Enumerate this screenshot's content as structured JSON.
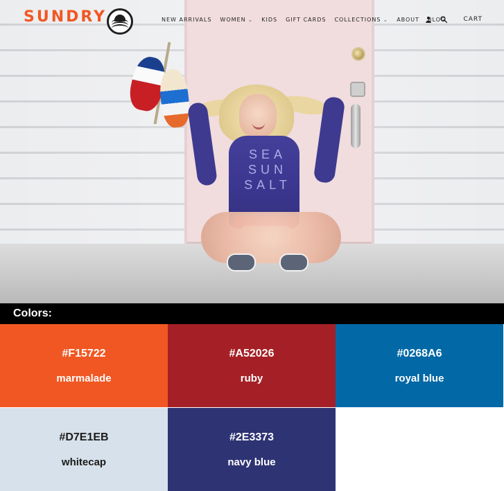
{
  "header": {
    "brand": "SUNDRY",
    "nav": [
      {
        "label": "NEW ARRIVALS",
        "has_dropdown": false
      },
      {
        "label": "WOMEN",
        "has_dropdown": true
      },
      {
        "label": "KIDS",
        "has_dropdown": false
      },
      {
        "label": "GIFT CARDS",
        "has_dropdown": false
      },
      {
        "label": "COLLECTIONS",
        "has_dropdown": true
      },
      {
        "label": "ABOUT",
        "has_dropdown": false
      },
      {
        "label": "BLOG",
        "has_dropdown": false
      }
    ],
    "utils": {
      "account_icon": "user-icon",
      "search_icon": "search-icon",
      "cart_label": "CART"
    }
  },
  "hero": {
    "sweatshirt_text": "SEA\nSUN\nSALT"
  },
  "colors_section": {
    "title": "Colors:",
    "swatches": [
      {
        "hex": "#F15722",
        "name": "marmalade",
        "text_color": "#ffffff",
        "bg": "#F15722"
      },
      {
        "hex": "#A52026",
        "name": "ruby",
        "text_color": "#ffffff",
        "bg": "#A52026"
      },
      {
        "hex": "#0268A6",
        "name": "royal blue",
        "text_color": "#ffffff",
        "bg": "#0268A6"
      },
      {
        "hex": "#D7E1EB",
        "name": "whitecap",
        "text_color": "#1b1b1b",
        "bg": "#D7E1EB"
      },
      {
        "hex": "#2E3373",
        "name": "navy blue",
        "text_color": "#ffffff",
        "bg": "#2E3373"
      }
    ]
  },
  "theme": {
    "brand_orange": "#f15722",
    "header_text": "#1f1f1f",
    "colors_bar_bg": "#000000",
    "colors_bar_text": "#ffffff"
  }
}
